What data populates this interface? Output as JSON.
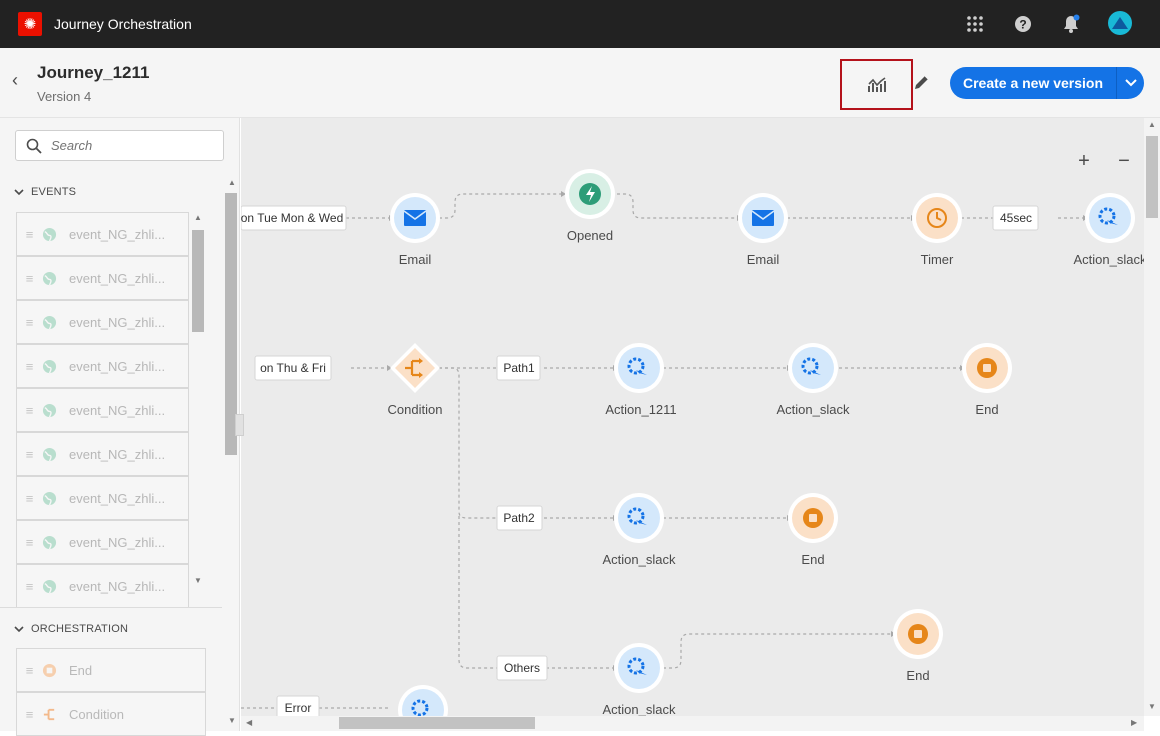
{
  "app": {
    "name": "Journey Orchestration"
  },
  "topbar": {
    "icons": [
      "apps-grid-icon",
      "help-icon",
      "notifications-icon",
      "avatar"
    ]
  },
  "header": {
    "journey_name": "Journey_1211",
    "version": "Version 4",
    "report_icon": "report-chart-icon",
    "edit_icon": "pencil-icon",
    "primary_button": "Create a new version"
  },
  "sidebar": {
    "search_placeholder": "Search",
    "sections": [
      {
        "title": "EVENTS",
        "items": [
          "event_NG_zhli...",
          "event_NG_zhli...",
          "event_NG_zhli...",
          "event_NG_zhli...",
          "event_NG_zhli...",
          "event_NG_zhli...",
          "event_NG_zhli...",
          "event_NG_zhli...",
          "event_NG_zhli..."
        ]
      },
      {
        "title": "ORCHESTRATION",
        "items": [
          "End",
          "Condition"
        ]
      }
    ]
  },
  "canvas": {
    "zoom_in": "+",
    "zoom_out": "−",
    "edge_labels": [
      "on Tue Mon & Wed",
      "45sec",
      "on Thu & Fri",
      "Path1",
      "Path2",
      "Others",
      "Error"
    ],
    "nodes": [
      "Email",
      "Opened",
      "Email",
      "Timer",
      "Action_slack",
      "Condition",
      "Action_1211",
      "Action_slack",
      "End",
      "Action_slack",
      "End",
      "End",
      "Action_slack"
    ]
  },
  "colors": {
    "primary": "#1473e6",
    "topbar": "#222222",
    "canvas": "#ebebeb",
    "node_blue": "#d4e8fb",
    "node_green": "#d8efe5",
    "node_orange": "#fbe0c7",
    "icon_blue": "#1473e6",
    "icon_green": "#2d9d78",
    "icon_orange": "#e68619",
    "highlight": "#b4121b"
  }
}
